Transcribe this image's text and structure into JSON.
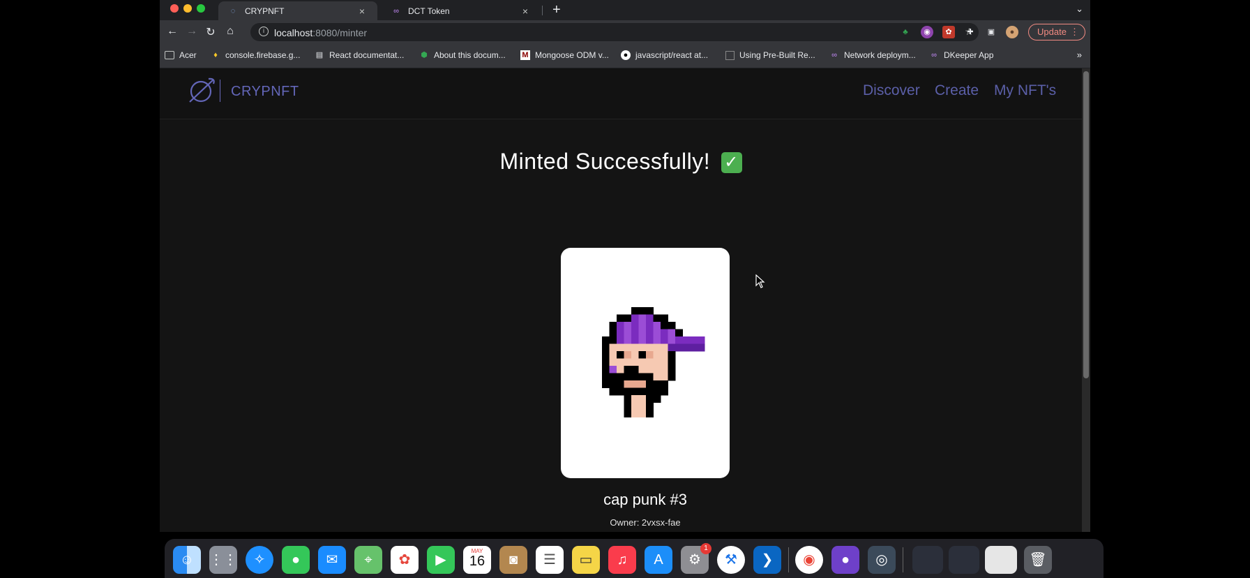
{
  "browser": {
    "tabs": [
      {
        "title": "CRYPNFT",
        "active": true
      },
      {
        "title": "DCT Token",
        "active": false
      }
    ],
    "new_tab_symbol": "+",
    "url_host": "localhost",
    "url_rest": ":8080/minter",
    "update_label": "Update",
    "bookmarks": [
      "Acer",
      "console.firebase.g...",
      "React documentat...",
      "About this docum...",
      "Mongoose ODM v...",
      "javascript/react at...",
      "Using Pre-Built Re...",
      "Network deploym...",
      "DKeeper App"
    ],
    "bookmarks_more": "»"
  },
  "app": {
    "brand": "CRYPNFT",
    "nav": {
      "discover": "Discover",
      "create": "Create",
      "my_nfts": "My NFT's"
    },
    "headline": "Minted Successfully!",
    "check_glyph": "✓",
    "nft": {
      "name": "cap punk #3",
      "owner": "Owner: 2vxsx-fae"
    }
  },
  "dock": {
    "calendar_month": "MAY",
    "calendar_day": "16",
    "settings_badge": "1"
  },
  "colors": {
    "brand": "#6366b8",
    "nav_link": "#5b5fa8",
    "update_accent": "#f28b82",
    "page_bg": "#141414",
    "cap_purple": "#7b2cbf",
    "skin": "#f6c9b2"
  }
}
